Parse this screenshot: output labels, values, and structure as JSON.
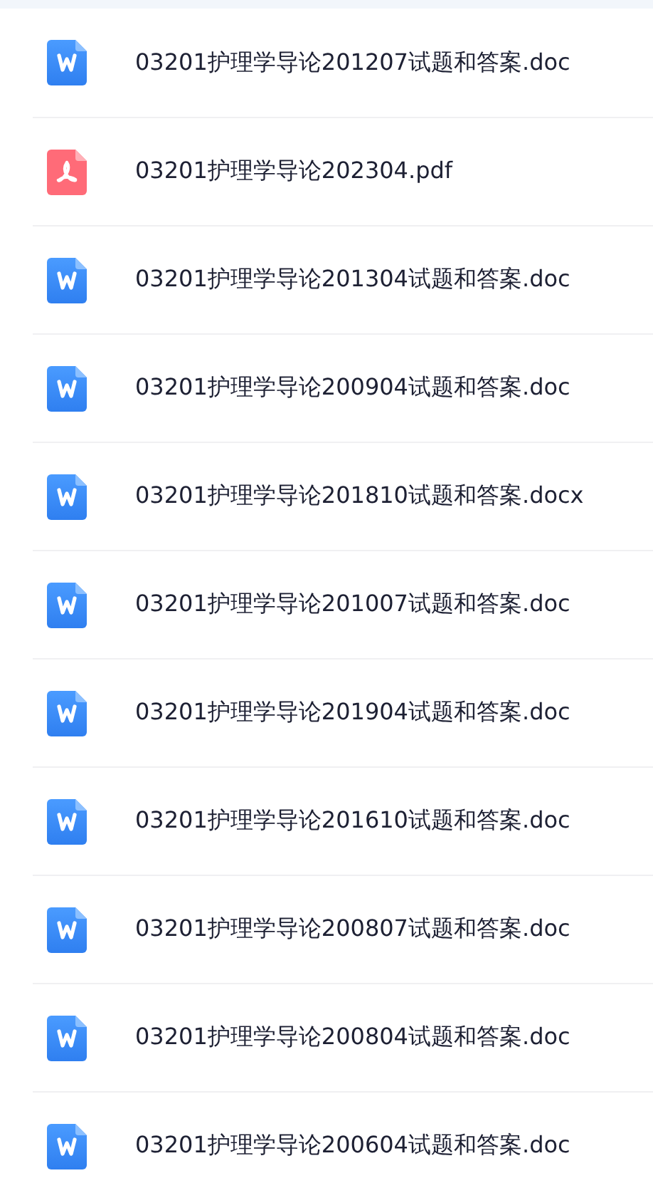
{
  "files": [
    {
      "name": "03201护理学导论201207试题和答案.doc",
      "kind": "word"
    },
    {
      "name": "03201护理学导论202304.pdf",
      "kind": "pdf"
    },
    {
      "name": "03201护理学导论201304试题和答案.doc",
      "kind": "word"
    },
    {
      "name": "03201护理学导论200904试题和答案.doc",
      "kind": "word"
    },
    {
      "name": "03201护理学导论201810试题和答案.docx",
      "kind": "word"
    },
    {
      "name": "03201护理学导论201007试题和答案.doc",
      "kind": "word"
    },
    {
      "name": "03201护理学导论201904试题和答案.doc",
      "kind": "word"
    },
    {
      "name": "03201护理学导论201610试题和答案.doc",
      "kind": "word"
    },
    {
      "name": "03201护理学导论200807试题和答案.doc",
      "kind": "word"
    },
    {
      "name": "03201护理学导论200804试题和答案.doc",
      "kind": "word"
    },
    {
      "name": "03201护理学导论200604试题和答案.doc",
      "kind": "word"
    }
  ]
}
